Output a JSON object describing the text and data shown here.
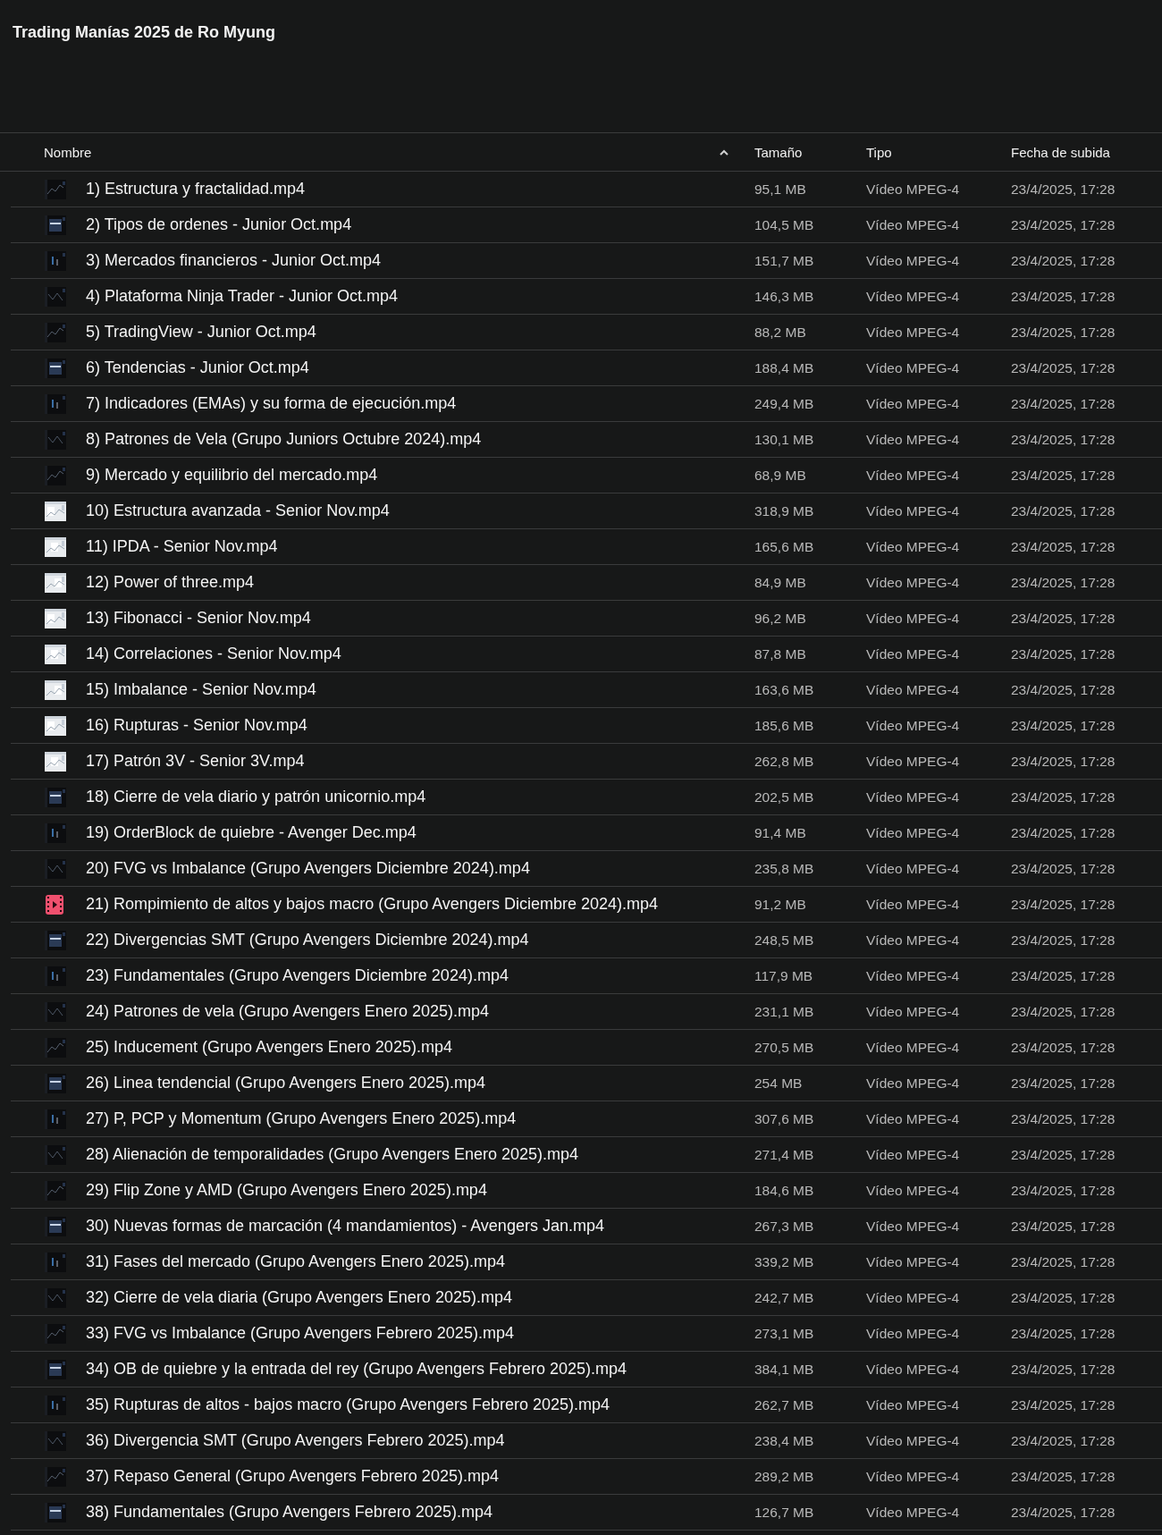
{
  "title": "Trading Manías 2025 de Ro Myung",
  "table": {
    "columns": [
      {
        "label": "Nombre",
        "sorted": true
      },
      {
        "label": "Tamaño",
        "sorted": false
      },
      {
        "label": "Tipo",
        "sorted": false
      },
      {
        "label": "Fecha de subida",
        "sorted": false
      }
    ],
    "rows": [
      {
        "name": "1) Estructura y fractalidad.mp4",
        "size": "95,1 MB",
        "type": "Vídeo MPEG-4",
        "uploaded": "23/4/2025, 17:28"
      },
      {
        "name": "2) Tipos de ordenes - Junior Oct.mp4",
        "size": "104,5 MB",
        "type": "Vídeo MPEG-4",
        "uploaded": "23/4/2025, 17:28"
      },
      {
        "name": "3) Mercados financieros - Junior Oct.mp4",
        "size": "151,7 MB",
        "type": "Vídeo MPEG-4",
        "uploaded": "23/4/2025, 17:28"
      },
      {
        "name": "4) Plataforma Ninja Trader - Junior Oct.mp4",
        "size": "146,3 MB",
        "type": "Vídeo MPEG-4",
        "uploaded": "23/4/2025, 17:28"
      },
      {
        "name": "5) TradingView - Junior Oct.mp4",
        "size": "88,2 MB",
        "type": "Vídeo MPEG-4",
        "uploaded": "23/4/2025, 17:28"
      },
      {
        "name": "6) Tendencias - Junior Oct.mp4",
        "size": "188,4 MB",
        "type": "Vídeo MPEG-4",
        "uploaded": "23/4/2025, 17:28"
      },
      {
        "name": "7) Indicadores (EMAs) y su forma de ejecución.mp4",
        "size": "249,4 MB",
        "type": "Vídeo MPEG-4",
        "uploaded": "23/4/2025, 17:28"
      },
      {
        "name": "8) Patrones de Vela (Grupo Juniors Octubre 2024).mp4",
        "size": "130,1 MB",
        "type": "Vídeo MPEG-4",
        "uploaded": "23/4/2025, 17:28"
      },
      {
        "name": "9) Mercado y equilibrio del mercado.mp4",
        "size": "68,9 MB",
        "type": "Vídeo MPEG-4",
        "uploaded": "23/4/2025, 17:28"
      },
      {
        "name": "10) Estructura avanzada - Senior Nov.mp4",
        "size": "318,9 MB",
        "type": "Vídeo MPEG-4",
        "uploaded": "23/4/2025, 17:28"
      },
      {
        "name": "11) IPDA - Senior Nov.mp4",
        "size": "165,6 MB",
        "type": "Vídeo MPEG-4",
        "uploaded": "23/4/2025, 17:28"
      },
      {
        "name": "12) Power of three.mp4",
        "size": "84,9 MB",
        "type": "Vídeo MPEG-4",
        "uploaded": "23/4/2025, 17:28"
      },
      {
        "name": "13) Fibonacci - Senior Nov.mp4",
        "size": "96,2 MB",
        "type": "Vídeo MPEG-4",
        "uploaded": "23/4/2025, 17:28"
      },
      {
        "name": "14) Correlaciones - Senior Nov.mp4",
        "size": "87,8 MB",
        "type": "Vídeo MPEG-4",
        "uploaded": "23/4/2025, 17:28"
      },
      {
        "name": "15) Imbalance - Senior Nov.mp4",
        "size": "163,6 MB",
        "type": "Vídeo MPEG-4",
        "uploaded": "23/4/2025, 17:28"
      },
      {
        "name": "16) Rupturas - Senior Nov.mp4",
        "size": "185,6 MB",
        "type": "Vídeo MPEG-4",
        "uploaded": "23/4/2025, 17:28"
      },
      {
        "name": "17) Patrón 3V - Senior 3V.mp4",
        "size": "262,8 MB",
        "type": "Vídeo MPEG-4",
        "uploaded": "23/4/2025, 17:28"
      },
      {
        "name": "18) Cierre de vela diario y patrón unicornio.mp4",
        "size": "202,5 MB",
        "type": "Vídeo MPEG-4",
        "uploaded": "23/4/2025, 17:28"
      },
      {
        "name": "19) OrderBlock de quiebre - Avenger Dec.mp4",
        "size": "91,4 MB",
        "type": "Vídeo MPEG-4",
        "uploaded": "23/4/2025, 17:28"
      },
      {
        "name": "20) FVG vs Imbalance (Grupo Avengers Diciembre 2024).mp4",
        "size": "235,8 MB",
        "type": "Vídeo MPEG-4",
        "uploaded": "23/4/2025, 17:28"
      },
      {
        "thumbnail": {
          "kind": "video-icon"
        },
        "name": "21) Rompimiento de altos y bajos macro (Grupo Avengers Diciembre 2024).mp4",
        "size": "91,2 MB",
        "type": "Vídeo MPEG-4",
        "uploaded": "23/4/2025, 17:28"
      },
      {
        "name": "22) Divergencias SMT (Grupo Avengers Diciembre 2024).mp4",
        "size": "248,5 MB",
        "type": "Vídeo MPEG-4",
        "uploaded": "23/4/2025, 17:28"
      },
      {
        "name": "23) Fundamentales (Grupo Avengers Diciembre 2024).mp4",
        "size": "117,9 MB",
        "type": "Vídeo MPEG-4",
        "uploaded": "23/4/2025, 17:28"
      },
      {
        "name": "24) Patrones de vela (Grupo Avengers Enero 2025).mp4",
        "size": "231,1 MB",
        "type": "Vídeo MPEG-4",
        "uploaded": "23/4/2025, 17:28"
      },
      {
        "name": "25) Inducement (Grupo Avengers Enero 2025).mp4",
        "size": "270,5 MB",
        "type": "Vídeo MPEG-4",
        "uploaded": "23/4/2025, 17:28"
      },
      {
        "name": "26) Linea tendencial (Grupo Avengers Enero 2025).mp4",
        "size": "254 MB",
        "type": "Vídeo MPEG-4",
        "uploaded": "23/4/2025, 17:28"
      },
      {
        "name": "27) P, PCP y Momentum (Grupo Avengers Enero 2025).mp4",
        "size": "307,6 MB",
        "type": "Vídeo MPEG-4",
        "uploaded": "23/4/2025, 17:28"
      },
      {
        "name": "28) Alienación de temporalidades (Grupo Avengers Enero 2025).mp4",
        "size": "271,4 MB",
        "type": "Vídeo MPEG-4",
        "uploaded": "23/4/2025, 17:28"
      },
      {
        "name": "29) Flip Zone y AMD (Grupo Avengers Enero 2025).mp4",
        "size": "184,6 MB",
        "type": "Vídeo MPEG-4",
        "uploaded": "23/4/2025, 17:28"
      },
      {
        "name": "30) Nuevas formas de marcación (4 mandamientos) - Avengers Jan.mp4",
        "size": "267,3 MB",
        "type": "Vídeo MPEG-4",
        "uploaded": "23/4/2025, 17:28"
      },
      {
        "name": "31) Fases del mercado (Grupo Avengers Enero 2025).mp4",
        "size": "339,2 MB",
        "type": "Vídeo MPEG-4",
        "uploaded": "23/4/2025, 17:28"
      },
      {
        "name": "32) Cierre de vela diaria (Grupo Avengers Enero 2025).mp4",
        "size": "242,7 MB",
        "type": "Vídeo MPEG-4",
        "uploaded": "23/4/2025, 17:28"
      },
      {
        "name": "33) FVG vs Imbalance (Grupo Avengers Febrero 2025).mp4",
        "size": "273,1 MB",
        "type": "Vídeo MPEG-4",
        "uploaded": "23/4/2025, 17:28"
      },
      {
        "name": "34) OB de quiebre y la entrada del rey (Grupo Avengers Febrero 2025).mp4",
        "size": "384,1 MB",
        "type": "Vídeo MPEG-4",
        "uploaded": "23/4/2025, 17:28"
      },
      {
        "name": "35) Rupturas de altos - bajos macro (Grupo Avengers Febrero 2025).mp4",
        "size": "262,7 MB",
        "type": "Vídeo MPEG-4",
        "uploaded": "23/4/2025, 17:28"
      },
      {
        "name": "36) Divergencia SMT (Grupo Avengers Febrero 2025).mp4",
        "size": "238,4 MB",
        "type": "Vídeo MPEG-4",
        "uploaded": "23/4/2025, 17:28"
      },
      {
        "name": "37) Repaso General (Grupo Avengers Febrero 2025).mp4",
        "size": "289,2 MB",
        "type": "Vídeo MPEG-4",
        "uploaded": "23/4/2025, 17:28"
      },
      {
        "name": "38) Fundamentales (Grupo Avengers Febrero 2025).mp4",
        "size": "126,7 MB",
        "type": "Vídeo MPEG-4",
        "uploaded": "23/4/2025, 17:28"
      }
    ]
  }
}
